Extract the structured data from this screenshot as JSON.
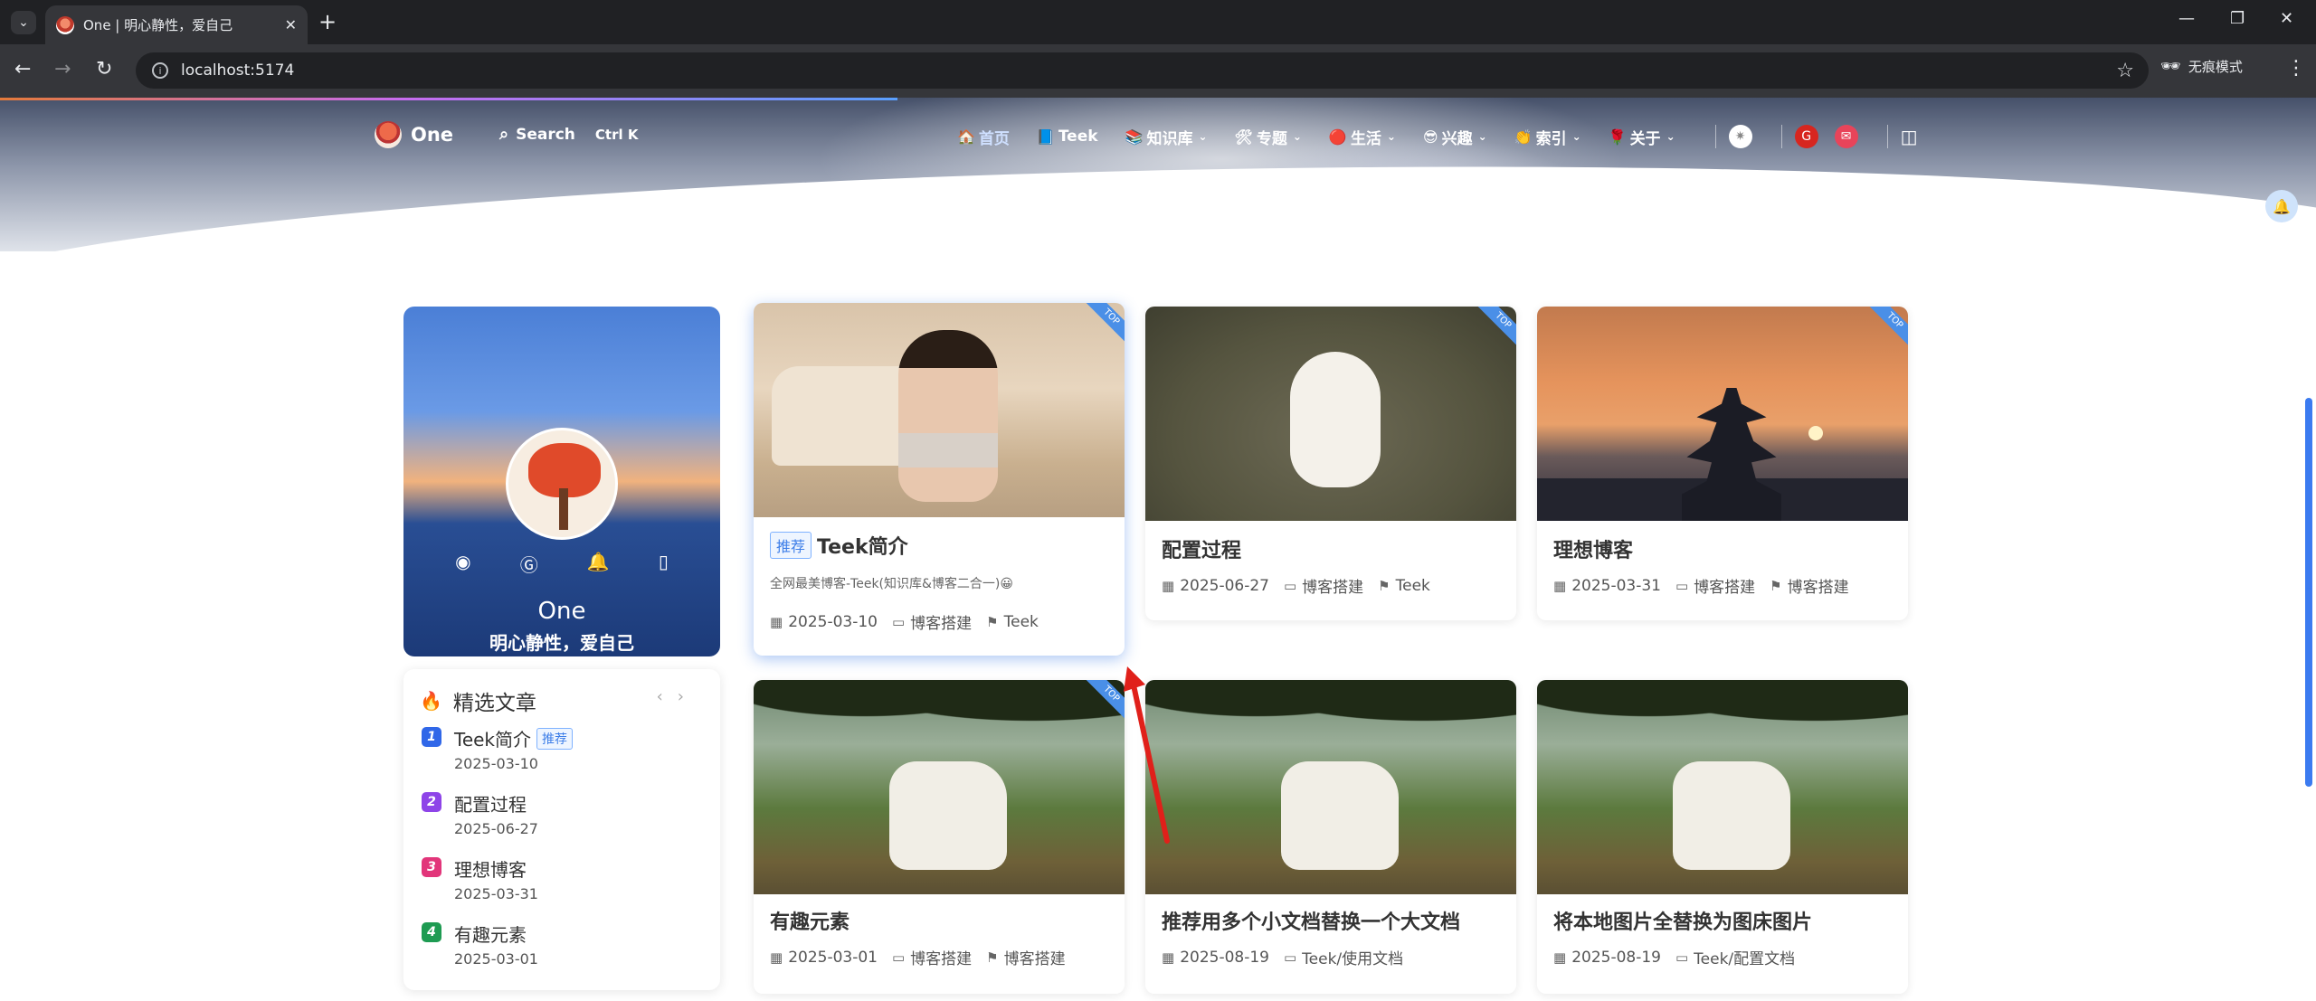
{
  "browser": {
    "tab_title": "One | 明心静性，爱自己",
    "url": "localhost:5174",
    "incognito_label": "无痕模式"
  },
  "nav": {
    "logo": "One",
    "search_label": "Search",
    "search_shortcut": "Ctrl K",
    "items": [
      {
        "icon": "🏠",
        "label": "首页",
        "active": true,
        "dropdown": false
      },
      {
        "icon": "📘",
        "label": "Teek",
        "dropdown": false
      },
      {
        "icon": "📚",
        "label": "知识库",
        "dropdown": true
      },
      {
        "icon": "🛠",
        "label": "专题",
        "dropdown": true
      },
      {
        "icon": "🔴",
        "label": "生活",
        "dropdown": true
      },
      {
        "icon": "😎",
        "label": "兴趣",
        "dropdown": true
      },
      {
        "icon": "👏",
        "label": "索引",
        "dropdown": true
      },
      {
        "icon": "🌹",
        "label": "关于",
        "dropdown": true
      }
    ]
  },
  "profile": {
    "name": "One",
    "motto": "明心静性，爱自己"
  },
  "featured": {
    "title": "精选文章",
    "items": [
      {
        "num": "1",
        "title": "Teek简介",
        "tag": "推荐",
        "date": "2025-03-10",
        "color": "#3067e8"
      },
      {
        "num": "2",
        "title": "配置过程",
        "date": "2025-06-27",
        "color": "#8e44e8"
      },
      {
        "num": "3",
        "title": "理想博客",
        "date": "2025-03-31",
        "color": "#e2357a"
      },
      {
        "num": "4",
        "title": "有趣元素",
        "date": "2025-03-01",
        "color": "#1e9b52"
      }
    ]
  },
  "posts": [
    {
      "title": "Teek简介",
      "tag": "推荐",
      "desc": "全网最美博客-Teek(知识库&博客二合一)😀",
      "date": "2025-03-10",
      "category": "博客搭建",
      "label": "Teek",
      "ribbon": "TOP"
    },
    {
      "title": "配置过程",
      "date": "2025-06-27",
      "category": "博客搭建",
      "label": "Teek",
      "ribbon": "TOP"
    },
    {
      "title": "理想博客",
      "date": "2025-03-31",
      "category": "博客搭建",
      "label": "博客搭建",
      "ribbon": "TOP"
    },
    {
      "title": "有趣元素",
      "date": "2025-03-01",
      "category": "博客搭建",
      "label": "博客搭建",
      "ribbon": "TOP"
    },
    {
      "title": "推荐用多个小文档替换一个大文档",
      "date": "2025-08-19",
      "category": "Teek/使用文档"
    },
    {
      "title": "将本地图片全替换为图床图片",
      "date": "2025-08-19",
      "category": "Teek/配置文档"
    }
  ]
}
